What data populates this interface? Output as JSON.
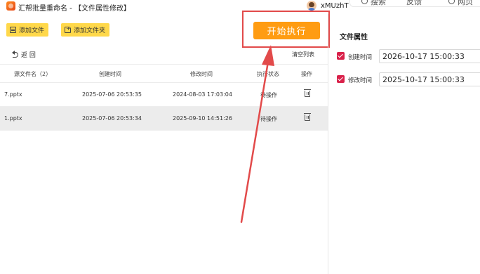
{
  "window": {
    "title": "汇帮批量重命名 - 【文件属性修改】",
    "user_name": "xMUzhTi"
  },
  "overlay_menu": [
    "搜索",
    "反馈",
    "网页"
  ],
  "toolbar": {
    "add_file_label": "添加文件",
    "add_folder_label": "添加文件夹",
    "start_label": "开始执行"
  },
  "subbar": {
    "back_label": "返 回",
    "clear_label": "清空列表"
  },
  "table": {
    "headers": {
      "filename": "源文件名（2）",
      "created": "创建时间",
      "modified": "修改时间",
      "status": "执行状态",
      "action": "操作"
    },
    "rows": [
      {
        "filename": "7.pptx",
        "created": "2025-07-06 20:53:35",
        "modified": "2024-08-03 17:03:04",
        "status": "待操作"
      },
      {
        "filename": "1.pptx",
        "created": "2025-07-06 20:53:34",
        "modified": "2025-09-10 14:51:26",
        "status": "待操作"
      }
    ]
  },
  "attributes": {
    "title": "文件属性",
    "created": {
      "label": "创建时间",
      "checked": true,
      "value": "2026-10-17 15:00:33"
    },
    "modified": {
      "label": "修改时间",
      "checked": true,
      "value": "2025-10-17 15:00:33"
    }
  },
  "colors": {
    "accent": "#ff9c12",
    "toolbar_button": "#ffd84a",
    "checkbox": "#d9214a",
    "annotation": "#e24a4a"
  }
}
